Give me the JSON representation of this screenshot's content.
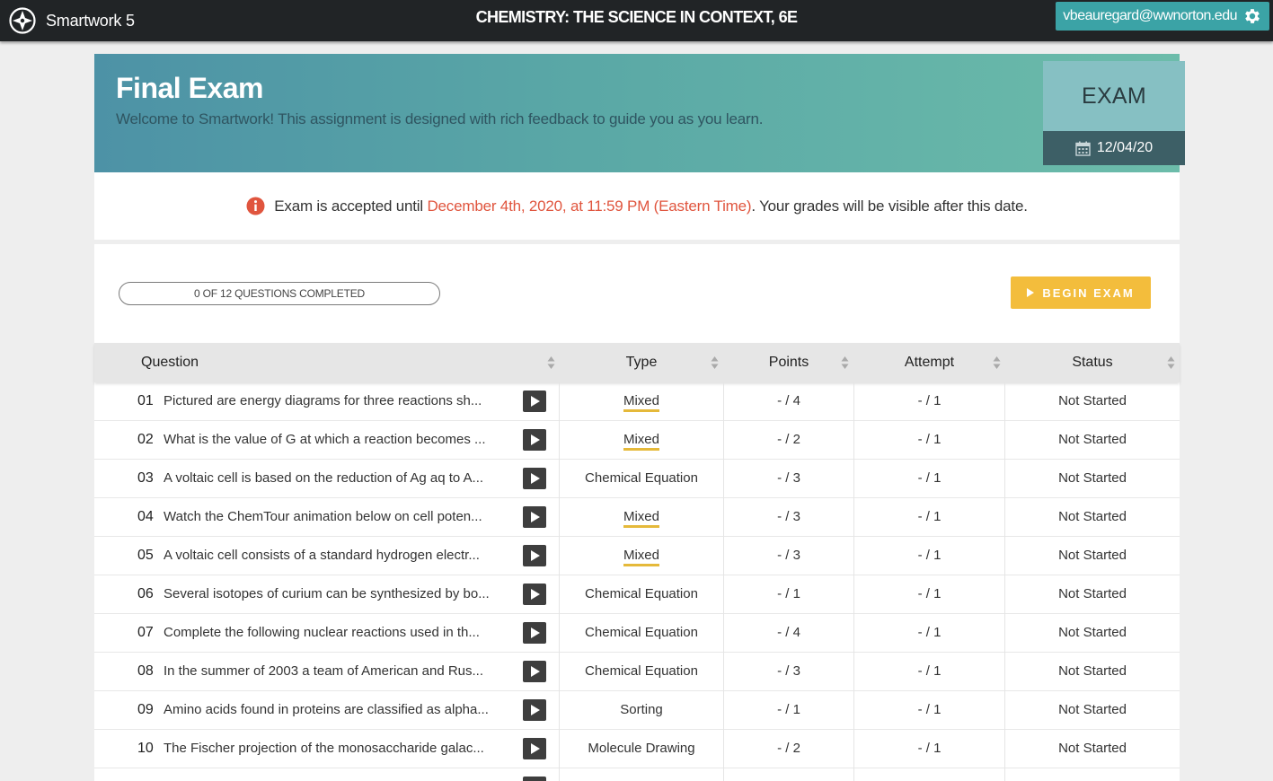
{
  "app": {
    "name": "Smartwork 5"
  },
  "course": {
    "title": "CHEMISTRY: THE SCIENCE IN CONTEXT, 6E"
  },
  "user": {
    "email": "vbeauregard@wwnorton.edu"
  },
  "banner": {
    "title": "Final Exam",
    "subtitle": "Welcome to Smartwork! This assignment is designed with rich feedback to guide you as you learn.",
    "badge_label": "EXAM",
    "due_date": "12/04/20"
  },
  "notice": {
    "prefix": "Exam is accepted until ",
    "deadline": "December 4th, 2020, at 11:59 PM (Eastern Time)",
    "suffix": ". Your grades will be visible after this date."
  },
  "progress": {
    "label": "0 OF 12 QUESTIONS COMPLETED",
    "completed": 0,
    "total": 12
  },
  "begin_button": {
    "label": "BEGIN EXAM"
  },
  "table": {
    "headers": {
      "question": "Question",
      "type": "Type",
      "points": "Points",
      "attempt": "Attempt",
      "status": "Status"
    },
    "rows": [
      {
        "num": "01",
        "text": "Pictured are energy diagrams for three reactions sh...",
        "type": "Mixed",
        "points": "- / 4",
        "attempt": "- / 1",
        "status": "Not Started"
      },
      {
        "num": "02",
        "text": "What is the value of G at which a reaction becomes ...",
        "type": "Mixed",
        "points": "- / 2",
        "attempt": "- / 1",
        "status": "Not Started"
      },
      {
        "num": "03",
        "text": "A voltaic cell is based on the reduction of Ag aq to A...",
        "type": "Chemical Equation",
        "points": "- / 3",
        "attempt": "- / 1",
        "status": "Not Started"
      },
      {
        "num": "04",
        "text": "Watch the ChemTour animation below on cell poten...",
        "type": "Mixed",
        "points": "- / 3",
        "attempt": "- / 1",
        "status": "Not Started"
      },
      {
        "num": "05",
        "text": "A voltaic cell consists of a standard hydrogen electr...",
        "type": "Mixed",
        "points": "- / 3",
        "attempt": "- / 1",
        "status": "Not Started"
      },
      {
        "num": "06",
        "text": "Several isotopes of curium can be synthesized by bo...",
        "type": "Chemical Equation",
        "points": "- / 1",
        "attempt": "- / 1",
        "status": "Not Started"
      },
      {
        "num": "07",
        "text": "Complete the following nuclear reactions used in th...",
        "type": "Chemical Equation",
        "points": "- / 4",
        "attempt": "- / 1",
        "status": "Not Started"
      },
      {
        "num": "08",
        "text": "In the summer of 2003 a team of American and Rus...",
        "type": "Chemical Equation",
        "points": "- / 3",
        "attempt": "- / 1",
        "status": "Not Started"
      },
      {
        "num": "09",
        "text": "Amino acids found in proteins are classified as alpha...",
        "type": "Sorting",
        "points": "- / 1",
        "attempt": "- / 1",
        "status": "Not Started"
      },
      {
        "num": "10",
        "text": "The Fischer projection of the monosaccharide galac...",
        "type": "Molecule Drawing",
        "points": "- / 2",
        "attempt": "- / 1",
        "status": "Not Started"
      }
    ]
  },
  "colors": {
    "navbar": "#212426",
    "user_box": "#3ba3a6",
    "accent_warning": "#e0553e",
    "begin_button": "#f3bd3c",
    "mixed_underline": "#e5b93a"
  },
  "icons": {
    "logo": "compass-icon",
    "settings": "gear-icon",
    "calendar": "calendar-icon",
    "info": "info-icon",
    "sort": "sort-icon",
    "play": "play-icon"
  }
}
